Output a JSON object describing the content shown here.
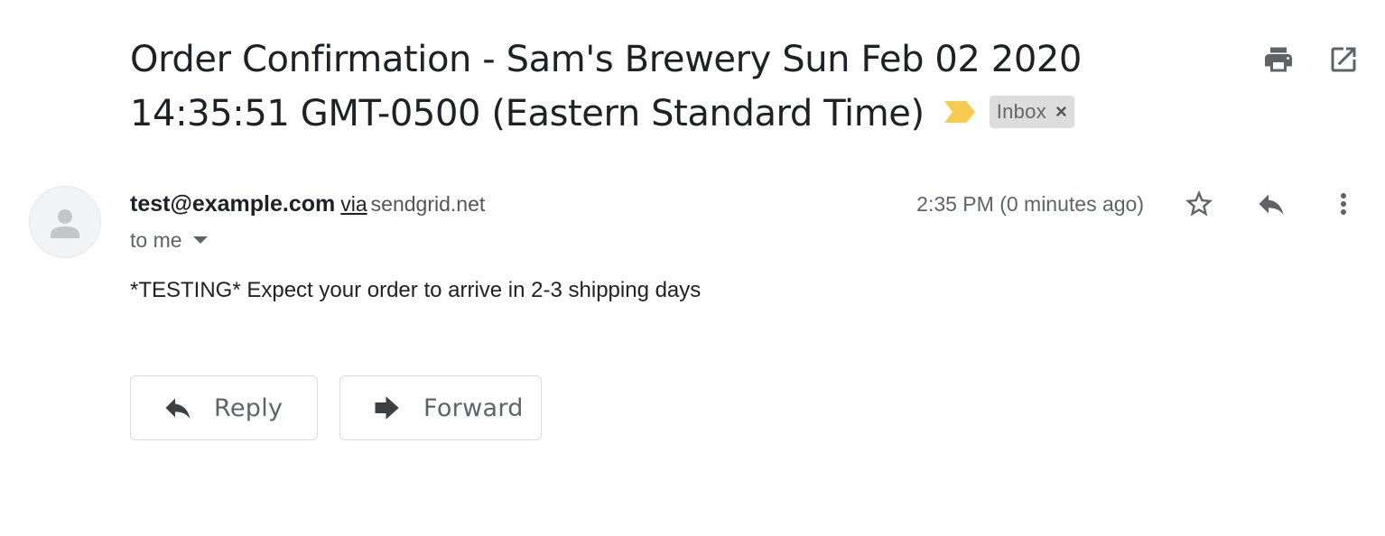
{
  "email": {
    "subject_line_1": "Order Confirmation - Sam's Brewery Sun Feb 02 2020",
    "subject_line_2": "14:35:51 GMT-0500 (Eastern Standard Time)",
    "label": "Inbox",
    "label_close": "×",
    "importance_color": "#f7cb4d",
    "sender_email": "test@example.com",
    "via_label": "via",
    "via_domain": "sendgrid.net",
    "recipient": "to me",
    "timestamp": "2:35 PM (0 minutes ago)",
    "body": "*TESTING* Expect your order to arrive in 2-3 shipping days"
  },
  "toolbar": {
    "print_icon": "print-icon",
    "open_new_window_icon": "open-in-new-window-icon"
  },
  "message_actions": {
    "star_icon": "star-icon",
    "reply_icon": "reply-icon",
    "more_icon": "more-vert-icon"
  },
  "buttons": {
    "reply_label": "Reply",
    "forward_label": "Forward"
  }
}
